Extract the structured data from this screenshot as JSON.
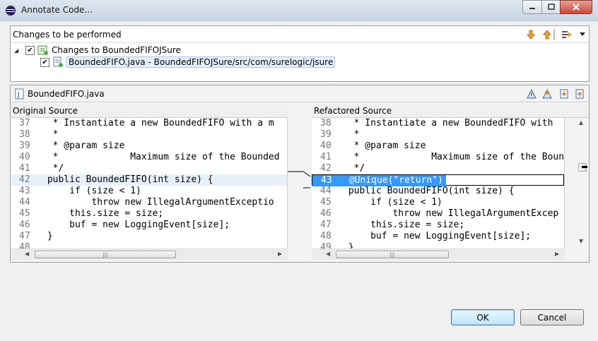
{
  "window": {
    "title": "Annotate Code...",
    "min_icon": "minimize-icon",
    "max_icon": "maximize-icon",
    "close_icon": "close-icon"
  },
  "changes": {
    "title": "Changes to be performed",
    "root": {
      "checked": true,
      "label": "Changes to BoundedFIFOJSure"
    },
    "child": {
      "checked": true,
      "label": "BoundedFIFO.java - BoundedFIFOJSure/src/com/surelogic/jsure"
    },
    "toolbar": [
      "next-change-icon",
      "previous-change-icon",
      "filter-icon",
      "dropdown-icon"
    ]
  },
  "compare": {
    "file": "BoundedFIFO.java",
    "toolbar": [
      "copy-all-left-to-right-icon",
      "copy-current-change-icon",
      "next-difference-icon",
      "previous-difference-icon"
    ],
    "left": {
      "title": "Original Source",
      "lines": [
        {
          "n": "37",
          "code": "  * Instantiate a new BoundedFIFO with a m"
        },
        {
          "n": "38",
          "code": "  *"
        },
        {
          "n": "39",
          "code": "  * @param size"
        },
        {
          "n": "40",
          "code": "  *             Maximum size of the Bounded"
        },
        {
          "n": "41",
          "code": "  */"
        },
        {
          "n": "42",
          "code": " public BoundedFIFO(int size) {"
        },
        {
          "n": "43",
          "code": "     if (size < 1)"
        },
        {
          "n": "44",
          "code": "         throw new IllegalArgumentExceptio"
        },
        {
          "n": "45",
          "code": "     this.size = size;"
        },
        {
          "n": "46",
          "code": "     buf = new LoggingEvent[size];"
        },
        {
          "n": "47",
          "code": " }"
        },
        {
          "n": "48",
          "code": ""
        }
      ]
    },
    "right": {
      "title": "Refactored Source",
      "lines": [
        {
          "n": "38",
          "code": "  * Instantiate a new BoundedFIFO with"
        },
        {
          "n": "39",
          "code": "  *"
        },
        {
          "n": "40",
          "code": "  * @param size"
        },
        {
          "n": "41",
          "code": "  *             Maximum size of the Boun"
        },
        {
          "n": "42",
          "code": "  */"
        },
        {
          "n": "43",
          "code": " @Unique(\"return\")"
        },
        {
          "n": "44",
          "code": " public BoundedFIFO(int size) {"
        },
        {
          "n": "45",
          "code": "     if (size < 1)"
        },
        {
          "n": "46",
          "code": "         throw new IllegalArgumentExcep"
        },
        {
          "n": "47",
          "code": "     this.size = size;"
        },
        {
          "n": "48",
          "code": "     buf = new LoggingEvent[size];"
        },
        {
          "n": "49",
          "code": " }"
        }
      ]
    }
  },
  "buttons": {
    "ok": "OK",
    "cancel": "Cancel"
  },
  "colors": {
    "selection": "#3399ff",
    "line_highlight": "#e8f0fa",
    "accent": "#f0a030"
  }
}
